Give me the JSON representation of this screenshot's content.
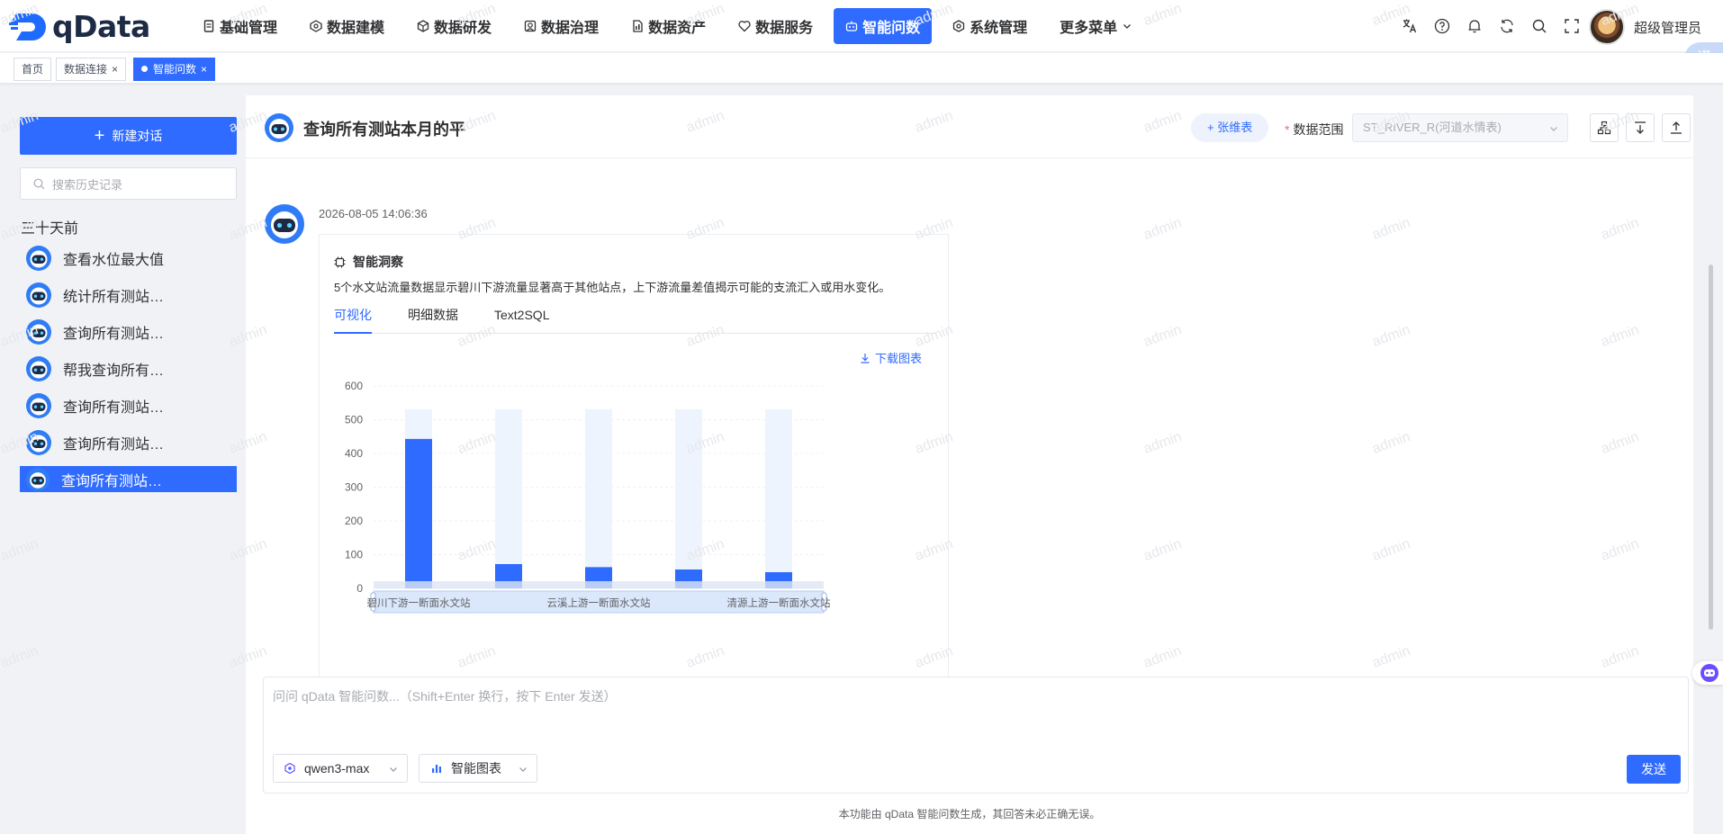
{
  "app": {
    "name": "qData"
  },
  "nav": [
    {
      "label": "基础管理",
      "icon": "database-icon"
    },
    {
      "label": "数据建模",
      "icon": "model-icon"
    },
    {
      "label": "数据研发",
      "icon": "cube-icon"
    },
    {
      "label": "数据治理",
      "icon": "governance-icon"
    },
    {
      "label": "数据资产",
      "icon": "asset-icon"
    },
    {
      "label": "数据服务",
      "icon": "service-icon"
    },
    {
      "label": "智能问数",
      "icon": "robot-icon",
      "active": true
    },
    {
      "label": "系统管理",
      "icon": "settings-icon"
    },
    {
      "label": "更多菜单",
      "icon": ""
    }
  ],
  "user": {
    "name": "超级管理员"
  },
  "translate": {
    "label": "译"
  },
  "tags": [
    {
      "label": "首页"
    },
    {
      "label": "数据连接",
      "close": "×"
    },
    {
      "label": "智能问数",
      "close": "×",
      "active": true
    }
  ],
  "sidebar": {
    "new_chat": "新建对话",
    "search_placeholder": "搜索历史记录",
    "group": "三十天前",
    "items": [
      {
        "label": "查看水位最大值"
      },
      {
        "label": "统计所有测站…"
      },
      {
        "label": "查询所有测站…"
      },
      {
        "label": "帮我查询所有…"
      },
      {
        "label": "查询所有测站…"
      },
      {
        "label": "查询所有测站…"
      },
      {
        "label": "查询所有测站…",
        "active": true
      }
    ]
  },
  "header": {
    "title": "查询所有测站本月的平",
    "add_table": "+ 张维表",
    "scope_required": "*",
    "scope_label": "数据范围",
    "scope_value": "ST_RIVER_R(河道水情表)"
  },
  "message": {
    "time": "2026-08-05 14:06:36",
    "insight_title": "智能洞察",
    "insight_text": "5个水文站流量数据显示碧川下游流量显著高于其他站点，上下游流量差值揭示可能的支流汇入或用水变化。",
    "tabs": [
      "可视化",
      "明细数据",
      "Text2SQL"
    ],
    "download": "下载图表"
  },
  "chart_data": {
    "type": "bar",
    "categories": [
      "碧川下游一断面水文站",
      "",
      "云溪上游一断面水文站",
      "",
      "清源上游一断面水文站"
    ],
    "values": [
      443,
      72,
      63,
      56,
      48
    ],
    "ylim": [
      0,
      600
    ],
    "yticks": [
      0,
      100,
      200,
      300,
      400,
      500,
      600
    ],
    "grid": true,
    "colors": {
      "bar": "#2f6bff",
      "background_bar": "#eef4fd"
    }
  },
  "composer": {
    "placeholder": "问问 qData 智能问数...（Shift+Enter 换行，按下 Enter 发送）",
    "model": "qwen3-max",
    "chart_mode": "智能图表",
    "send": "发送"
  },
  "disclaimer": "本功能由 qData 智能问数生成，其回答未必正确无误。",
  "watermark": "admin",
  "colors": {
    "accent": "#2f6bff",
    "required": "#f56c6c"
  }
}
